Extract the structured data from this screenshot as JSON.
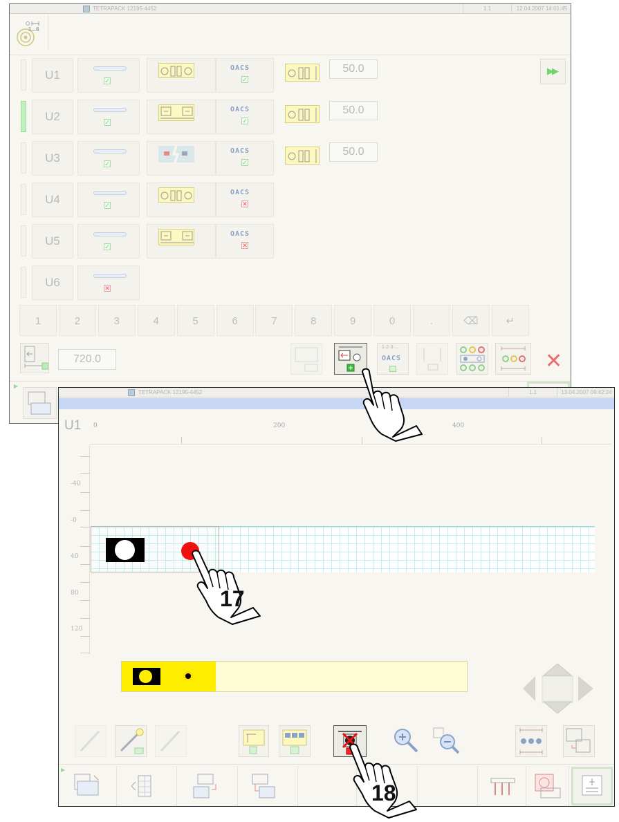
{
  "window1": {
    "title": "TETRAPACK 12195-4452",
    "page": "1.1",
    "datetime": "12.04.2007 14:01:45",
    "roll_counter": "1...6",
    "units": [
      {
        "label": "U1",
        "roll_ok": true,
        "mode": "plates",
        "oacs_ok": true,
        "distance": "50.0"
      },
      {
        "label": "U2",
        "roll_ok": true,
        "mode": "marks",
        "oacs_ok": true,
        "distance": "50.0"
      },
      {
        "label": "U3",
        "roll_ok": true,
        "mode": "broken",
        "oacs_ok": true,
        "distance": "50.0"
      },
      {
        "label": "U4",
        "roll_ok": true,
        "mode": "plates",
        "oacs_ok": false,
        "distance": ""
      },
      {
        "label": "U5",
        "roll_ok": true,
        "mode": "marks",
        "oacs_ok": false,
        "distance": ""
      },
      {
        "label": "U6",
        "roll_ok": false,
        "mode": "",
        "oacs_ok": null,
        "distance": ""
      }
    ],
    "keypad": [
      "1",
      "2",
      "3",
      "4",
      "5",
      "6",
      "7",
      "8",
      "9",
      "0",
      ".",
      "⌫",
      "↵"
    ],
    "repeat_length": "720.0",
    "oacs_text": "OACS",
    "oacs_seq": "1·2·3·..."
  },
  "window2": {
    "title": "TETRAPACK 12195-4452",
    "page": "1.1",
    "datetime": "13.04.2007 09:42:24",
    "unit": "U1",
    "x_ticks": [
      "0",
      "200",
      "400"
    ],
    "y_ticks": [
      "-40",
      "-0",
      "40",
      "80",
      "120"
    ]
  },
  "callouts": {
    "step17": "17",
    "step18": "18"
  },
  "colors": {
    "marker_red": "#f01010",
    "yellow": "#ffee00",
    "grid": "#bfeef4",
    "header_blue": "#c7d7f3"
  }
}
